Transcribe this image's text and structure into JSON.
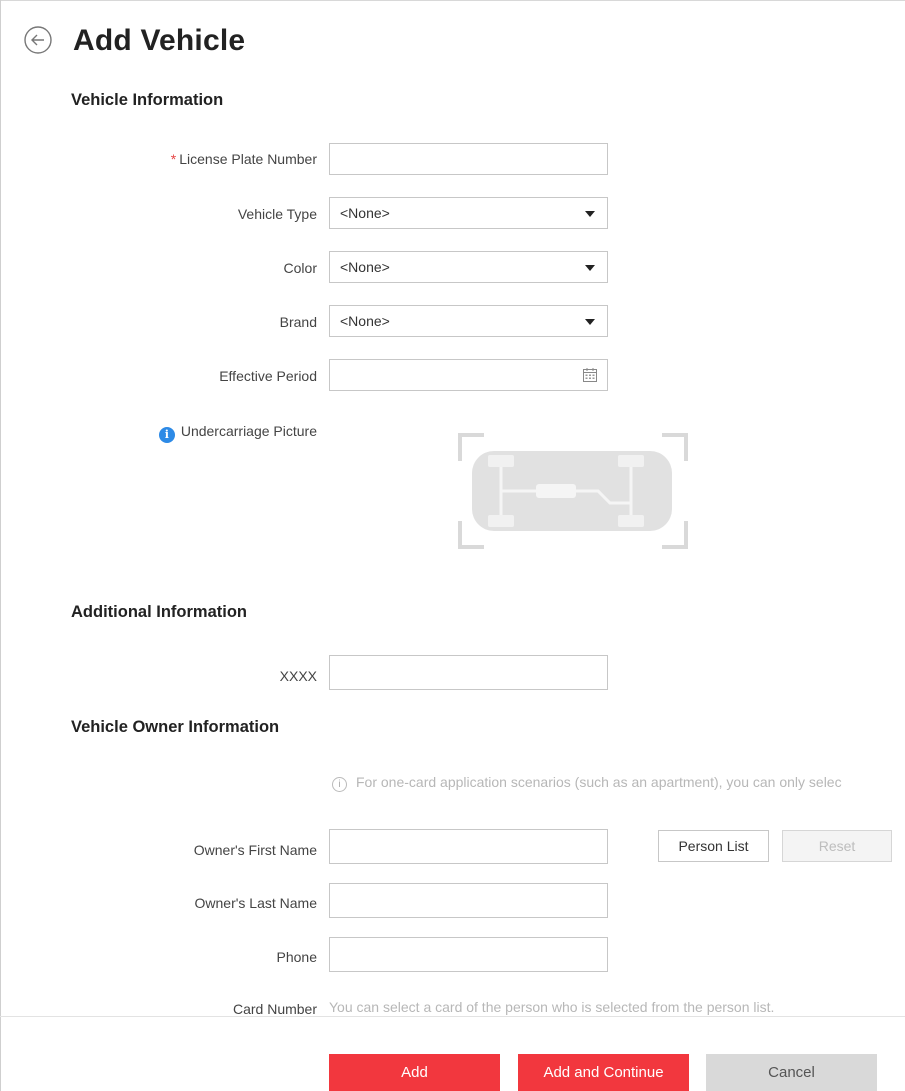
{
  "header": {
    "title": "Add Vehicle",
    "back_icon": "back-arrow-circle-icon"
  },
  "vehicle_info": {
    "section_title": "Vehicle Information",
    "license_plate": {
      "required_mark": "*",
      "label": "License Plate Number",
      "value": ""
    },
    "vehicle_type": {
      "label": "Vehicle Type",
      "value": "<None>"
    },
    "color": {
      "label": "Color",
      "value": "<None>"
    },
    "brand": {
      "label": "Brand",
      "value": "<None>"
    },
    "effective_period": {
      "label": "Effective Period",
      "value": "",
      "icon": "calendar-icon"
    },
    "undercarriage": {
      "label": "Undercarriage Picture",
      "info_icon": "i",
      "picture_icon": "car-undercarriage-icon"
    }
  },
  "additional_info": {
    "section_title": "Additional Information",
    "xxxx": {
      "label": "XXXX",
      "value": ""
    }
  },
  "owner_info": {
    "section_title": "Vehicle Owner Information",
    "hint": "For one-card application scenarios (such as an apartment), you can only selec",
    "hint_icon": "i",
    "first_name": {
      "label": "Owner's First Name",
      "value": ""
    },
    "last_name": {
      "label": "Owner's Last Name",
      "value": ""
    },
    "phone": {
      "label": "Phone",
      "value": ""
    },
    "card_number": {
      "label": "Card Number",
      "hint": "You can select a card of the person who is selected from the person list."
    },
    "person_list_button": "Person List",
    "reset_button": "Reset"
  },
  "footer": {
    "add_button": "Add",
    "add_continue_button": "Add and Continue",
    "cancel_button": "Cancel"
  },
  "colors": {
    "primary": "#f2373e",
    "info_blue": "#2d8ae6",
    "required": "#e64545"
  }
}
